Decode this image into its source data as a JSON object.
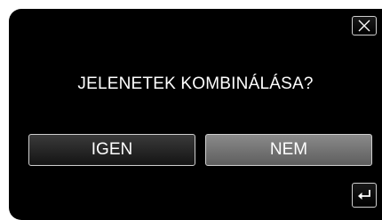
{
  "dialog": {
    "question": "JELENETEK KOMBINÁLÁSA?",
    "yes_label": "IGEN",
    "no_label": "NEM",
    "close_icon": "close-icon",
    "back_icon": "back-arrow-icon"
  },
  "colors": {
    "background": "#000000",
    "text": "#ffffff",
    "yes_button": "#2a2a2a",
    "no_button": "#767676",
    "border": "#cfcfcf"
  }
}
